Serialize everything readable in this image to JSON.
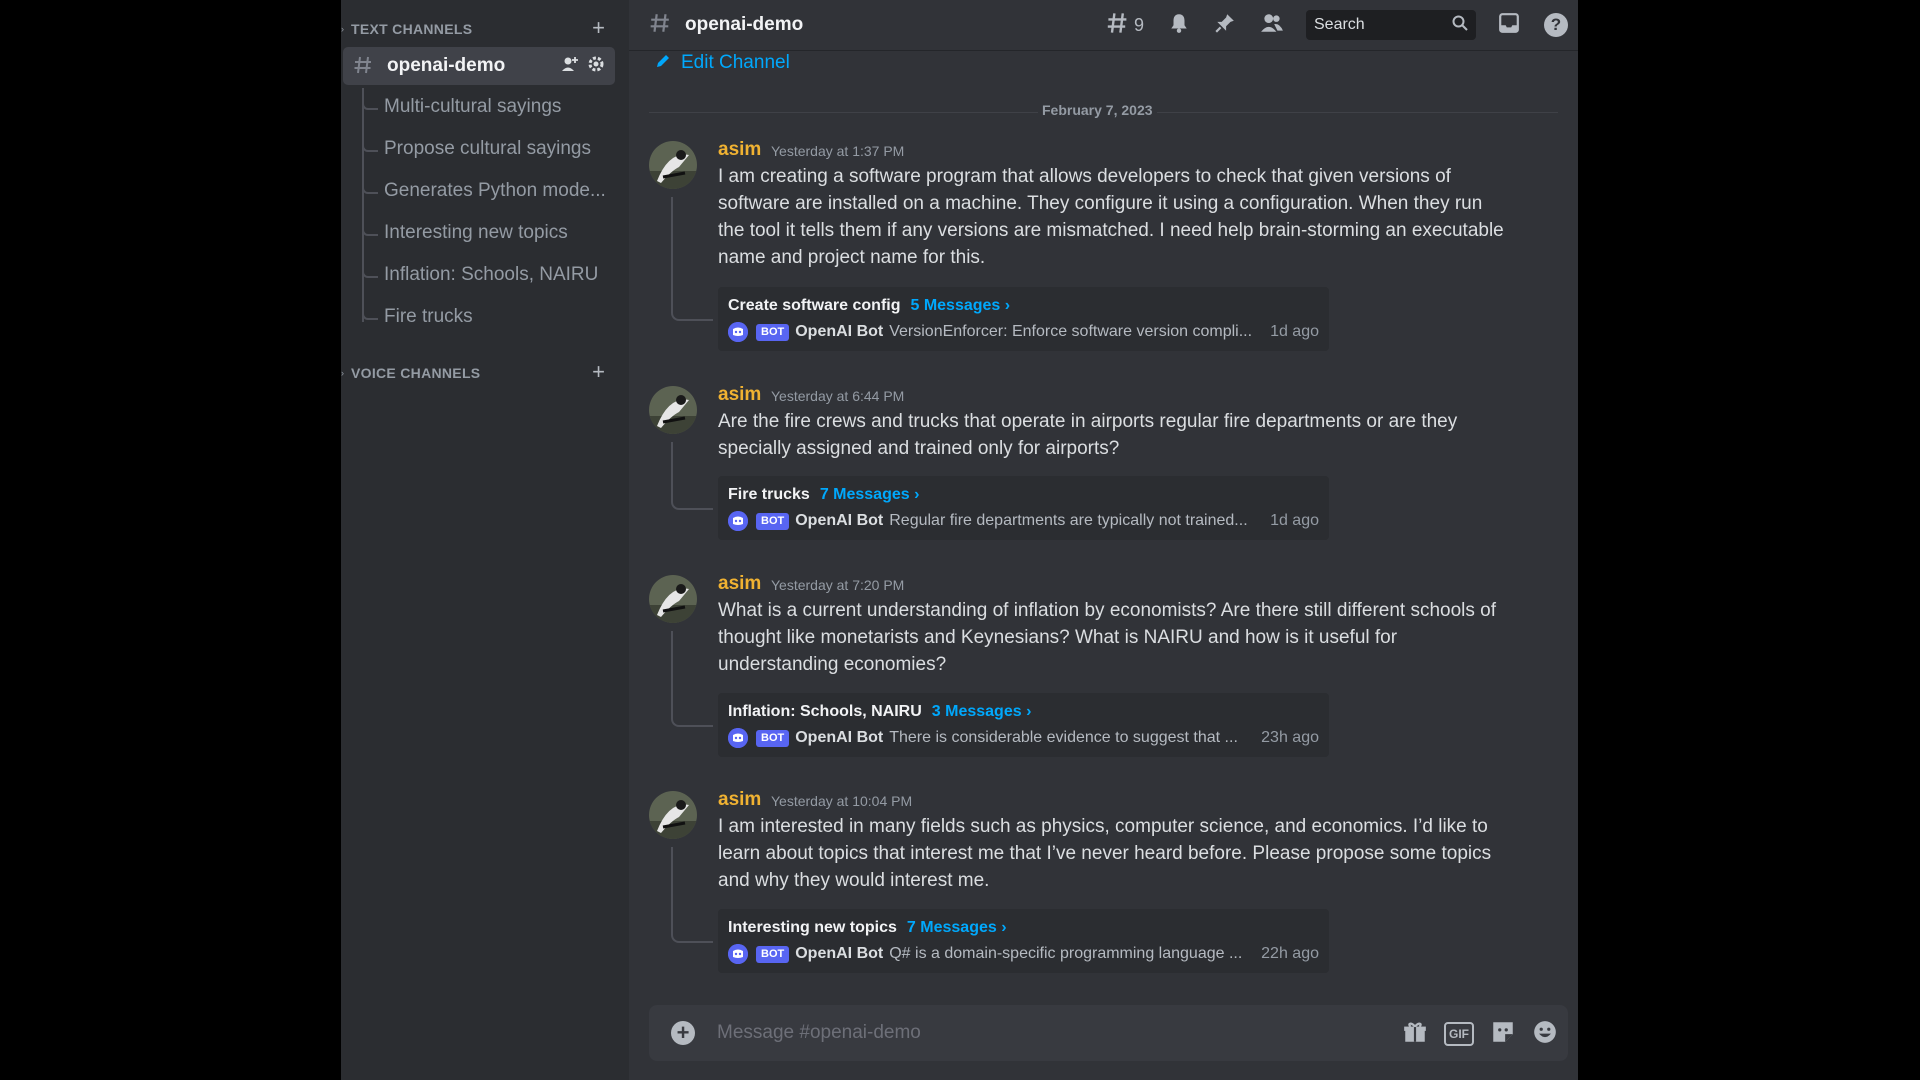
{
  "sidebar": {
    "text_channels_label": "TEXT CHANNELS",
    "voice_channels_label": "VOICE CHANNELS",
    "active_channel": "openai-demo",
    "threads": [
      "Multi-cultural sayings",
      "Propose cultural sayings",
      "Generates Python mode...",
      "Interesting new topics",
      "Inflation: Schools, NAIRU",
      "Fire trucks"
    ]
  },
  "header": {
    "channel_name": "openai-demo",
    "threads_count": "9",
    "search_placeholder": "Search",
    "help": "?"
  },
  "edit_channel_label": "Edit Channel",
  "date_divider": "February 7, 2023",
  "messages": [
    {
      "author": "asim",
      "time": "Yesterday at 1:37 PM",
      "content": "I am creating a software program that allows developers to check that given versions of software are installed on a machine. They configure it using a configuration. When they run the tool it tells them if any versions are mismatched. I need help brain-storming an executable name and project name for this.",
      "thread": {
        "name": "Create software config",
        "count": "5 Messages ›",
        "badge": "BOT",
        "bot_name": "OpenAI Bot",
        "snippet": "VersionEnforcer: Enforce software version compli...",
        "age": "1d ago"
      }
    },
    {
      "author": "asim",
      "time": "Yesterday at 6:44 PM",
      "content": "Are the fire crews and trucks that operate in airports regular fire departments or are they specially assigned and trained only for airports?",
      "thread": {
        "name": "Fire trucks",
        "count": "7 Messages ›",
        "badge": "BOT",
        "bot_name": "OpenAI Bot",
        "snippet": "Regular fire departments are typically not trained...",
        "age": "1d ago"
      }
    },
    {
      "author": "asim",
      "time": "Yesterday at 7:20 PM",
      "content": "What is a current understanding of inflation by economists? Are there still different schools of thought like monetarists and Keynesians? What is NAIRU and how is it useful for understanding economies?",
      "thread": {
        "name": "Inflation: Schools, NAIRU",
        "count": "3 Messages ›",
        "badge": "BOT",
        "bot_name": "OpenAI Bot",
        "snippet": "There is considerable evidence to suggest that ...",
        "age": "23h ago"
      }
    },
    {
      "author": "asim",
      "time": "Yesterday at 10:04 PM",
      "content": "I am interested in many fields such as physics, computer science, and economics. I’d like to learn about topics that interest me that I’ve never heard before. Please propose some topics and why they would interest me.",
      "thread": {
        "name": "Interesting new topics",
        "count": "7 Messages ›",
        "badge": "BOT",
        "bot_name": "OpenAI Bot",
        "snippet": "Q# is a domain-specific programming language ...",
        "age": "22h ago"
      }
    }
  ],
  "composer": {
    "placeholder": "Message #openai-demo",
    "gif_label": "GIF"
  },
  "colors": {
    "author": "#f0b232",
    "link": "#00a8fc",
    "blurple": "#5865f2",
    "sidebar_bg": "#2b2d31",
    "chat_bg": "#313338"
  }
}
